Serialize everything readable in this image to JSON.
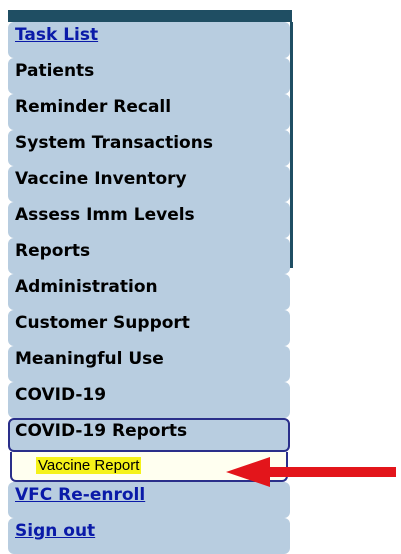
{
  "nav": {
    "items": [
      {
        "label": "Task List"
      },
      {
        "label": "Patients"
      },
      {
        "label": "Reminder Recall"
      },
      {
        "label": "System Transactions"
      },
      {
        "label": "Vaccine Inventory"
      },
      {
        "label": "Assess Imm Levels"
      },
      {
        "label": "Reports"
      },
      {
        "label": "Administration"
      },
      {
        "label": "Customer Support"
      },
      {
        "label": "Meaningful Use"
      },
      {
        "label": "COVID-19"
      },
      {
        "label": "COVID-19 Reports"
      },
      {
        "label": "VFC Re-enroll"
      },
      {
        "label": "Sign out"
      }
    ],
    "subitem": {
      "label": "Vaccine Report"
    }
  },
  "colors": {
    "header_bar": "#1f4e63",
    "nav_item_bg": "#b8cde0",
    "selected_border": "#2a2f8a",
    "link_text": "#0a1aa8",
    "highlight": "#f5f21a",
    "arrow": "#e3151b"
  }
}
